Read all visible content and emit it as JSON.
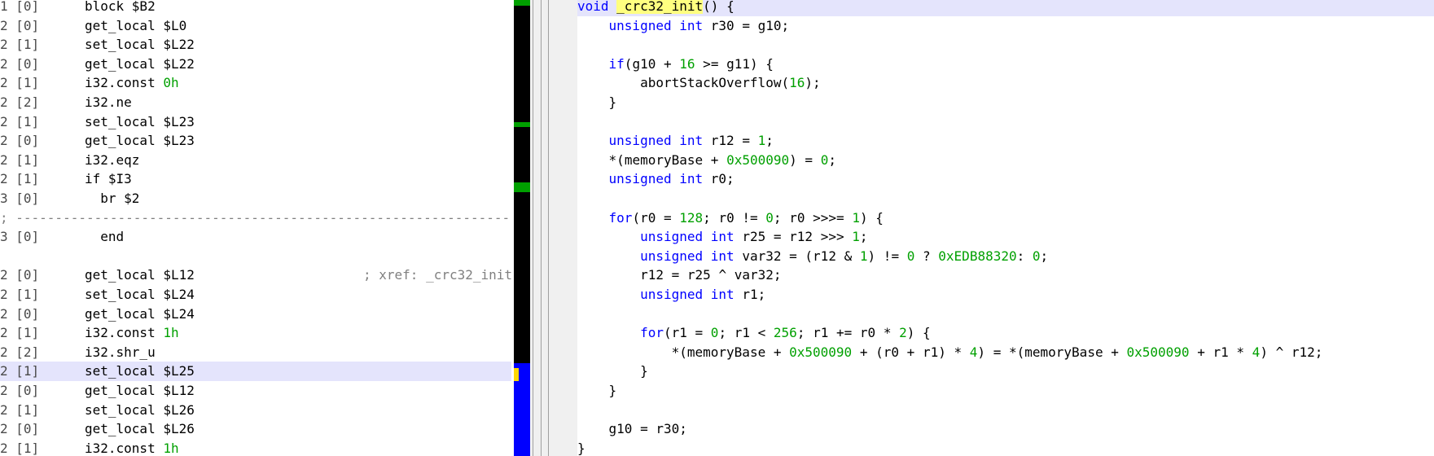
{
  "disassembly": {
    "lines": [
      {
        "level": "1 [0]",
        "text": "block $B2"
      },
      {
        "level": "2 [0]",
        "text": "get_local $L0"
      },
      {
        "level": "2 [1]",
        "text": "set_local $L22"
      },
      {
        "level": "2 [0]",
        "text": "get_local $L22"
      },
      {
        "level": "2 [1]",
        "text": "i32.const ",
        "num": "0h"
      },
      {
        "level": "2 [2]",
        "text": "i32.ne"
      },
      {
        "level": "2 [1]",
        "text": "set_local $L23"
      },
      {
        "level": "2 [0]",
        "text": "get_local $L23"
      },
      {
        "level": "2 [1]",
        "text": "i32.eqz"
      },
      {
        "level": "2 [1]",
        "text": "if $I3"
      },
      {
        "level": "3 [0]",
        "text": "  br $2"
      },
      {
        "separator": "; ----------------------------------------------------------------------"
      },
      {
        "level": "3 [0]",
        "text": "  end"
      },
      {
        "blank": true
      },
      {
        "level": "2 [0]",
        "text": "get_local $L12",
        "comment": "; xref: _crc32_init"
      },
      {
        "level": "2 [1]",
        "text": "set_local $L24"
      },
      {
        "level": "2 [0]",
        "text": "get_local $L24"
      },
      {
        "level": "2 [1]",
        "text": "i32.const ",
        "num": "1h"
      },
      {
        "level": "2 [2]",
        "text": "i32.shr_u"
      },
      {
        "level": "2 [1]",
        "text": "set_local $L25",
        "highlight": true
      },
      {
        "level": "2 [0]",
        "text": "get_local $L12"
      },
      {
        "level": "2 [1]",
        "text": "set_local $L26"
      },
      {
        "level": "2 [0]",
        "text": "get_local $L26"
      },
      {
        "level": "2 [1]",
        "text": "i32.const ",
        "num": "1h"
      }
    ]
  },
  "overview_colors": {
    "code": "#00a000",
    "data": "#0000ff",
    "cursor": "#ffd700",
    "empty": "#000000"
  },
  "decompiler": {
    "lines": [
      {
        "t": "void _crc32_init() {",
        "highlight": true
      },
      {
        "t": "    unsigned int r30 = g10;"
      },
      {
        "t": ""
      },
      {
        "t": "    if(g10 + 16 >= g11) {"
      },
      {
        "t": "        abortStackOverflow(16);"
      },
      {
        "t": "    }"
      },
      {
        "t": ""
      },
      {
        "t": "    unsigned int r12 = 1;"
      },
      {
        "t": "    *(memoryBase + 0x500090) = 0;"
      },
      {
        "t": "    unsigned int r0;"
      },
      {
        "t": ""
      },
      {
        "t": "    for(r0 = 128; r0 != 0; r0 >>>= 1) {"
      },
      {
        "t": "        unsigned int r25 = r12 >>> 1;"
      },
      {
        "t": "        unsigned int var32 = (r12 & 1) != 0 ? 0xEDB88320: 0;"
      },
      {
        "t": "        r12 = r25 ^ var32;"
      },
      {
        "t": "        unsigned int r1;"
      },
      {
        "t": ""
      },
      {
        "t": "        for(r1 = 0; r1 < 256; r1 += r0 * 2) {"
      },
      {
        "t": "            *(memoryBase + 0x500090 + (r0 + r1) * 4) = *(memoryBase + 0x500090 + r1 * 4) ^ r12;"
      },
      {
        "t": "        }"
      },
      {
        "t": "    }"
      },
      {
        "t": ""
      },
      {
        "t": "    g10 = r30;"
      },
      {
        "t": "}"
      }
    ],
    "keywords": [
      "void",
      "unsigned",
      "int",
      "if",
      "for"
    ],
    "function_name": "_crc32_init"
  }
}
